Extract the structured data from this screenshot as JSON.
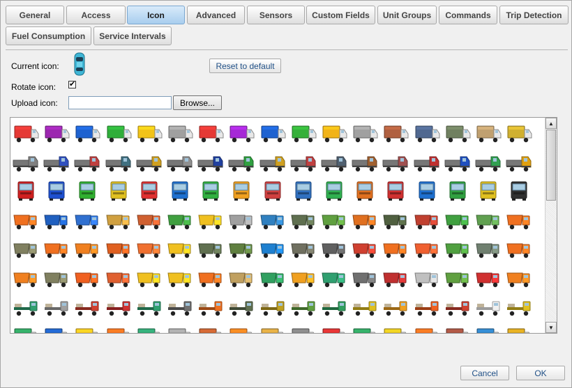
{
  "tabs": [
    {
      "label": "General",
      "active": false
    },
    {
      "label": "Access",
      "active": false
    },
    {
      "label": "Icon",
      "active": true
    },
    {
      "label": "Advanced",
      "active": false
    },
    {
      "label": "Sensors",
      "active": false
    },
    {
      "label": "Custom Fields",
      "active": false
    },
    {
      "label": "Unit Groups",
      "active": false
    },
    {
      "label": "Commands",
      "active": false
    },
    {
      "label": "Trip Detection",
      "active": false
    },
    {
      "label": "Fuel Consumption",
      "active": false
    },
    {
      "label": "Service Intervals",
      "active": false
    }
  ],
  "icon_form": {
    "current_icon_label": "Current icon:",
    "current_icon_name": "car-topview-icon",
    "current_icon_color": "#3fb6d6",
    "reset_label": "Reset to default",
    "rotate_label": "Rotate icon:",
    "rotate_checked": true,
    "rotate_mark": "✔",
    "upload_label": "Upload icon:",
    "upload_value": "",
    "browse_label": "Browse..."
  },
  "gallery": {
    "name": "vehicle-icon-gallery",
    "rows": [
      {
        "kind": "box-truck",
        "colors": [
          "#e53935",
          "#9c27b0",
          "#1e62d0",
          "#2fae3a",
          "#f2c318",
          "#a0a0a0",
          "#e53935",
          "#a629d6",
          "#1e62d0",
          "#35b03a",
          "#f2b318",
          "#a0a0a0",
          "#b06040",
          "#506890",
          "#708060",
          "#c0a070",
          "#d0b030"
        ]
      },
      {
        "kind": "semi-truck",
        "colors": [
          "#808080",
          "#3050c0",
          "#c04040",
          "#407080",
          "#d0a020",
          "#909090",
          "#2040a0",
          "#30a040",
          "#d0a020",
          "#c04040",
          "#506070",
          "#a06030",
          "#a05050",
          "#c03030",
          "#2050c0",
          "#30a050",
          "#e0a010"
        ]
      },
      {
        "kind": "cab-front",
        "colors": [
          "#d02020",
          "#1e50d0",
          "#30b030",
          "#e0c020",
          "#e03030",
          "#1e70d0",
          "#30b040",
          "#f0a020",
          "#d04040",
          "#3070c0",
          "#30b050",
          "#e07020",
          "#d03030",
          "#1e70d0",
          "#30a040",
          "#e0c020",
          "#303030"
        ]
      },
      {
        "kind": "dump-truck",
        "colors": [
          "#f07020",
          "#2060c0",
          "#3070d0",
          "#d0a040",
          "#d06030",
          "#40a040",
          "#f0c020",
          "#a0a0a0",
          "#3080c0",
          "#607050",
          "#60a040",
          "#e07020",
          "#506040",
          "#c04030",
          "#40a040",
          "#60a050",
          "#f07020"
        ]
      },
      {
        "kind": "dump-truck",
        "colors": [
          "#808060",
          "#f07020",
          "#f08020",
          "#e06020",
          "#f07030",
          "#f0c020",
          "#607050",
          "#608040",
          "#1e80d0",
          "#707060",
          "#606060",
          "#d04030",
          "#f07020",
          "#f06030",
          "#50a040",
          "#708070",
          "#f07020"
        ]
      },
      {
        "kind": "dump-truck",
        "colors": [
          "#f08020",
          "#808060",
          "#f06020",
          "#e06030",
          "#f0c020",
          "#f0c020",
          "#f07020",
          "#c0a060",
          "#30a060",
          "#f0a020",
          "#30a070",
          "#707070",
          "#c03030",
          "#c0c0c0",
          "#60a040",
          "#d03030",
          "#f08020"
        ]
      },
      {
        "kind": "flatbed-truck",
        "colors": [
          "#30a070",
          "#a0a0a0",
          "#d04030",
          "#d03030",
          "#30a070",
          "#707070",
          "#f07020",
          "#607050",
          "#c0a020",
          "#60a040",
          "#30a060",
          "#e0c020",
          "#f0a020",
          "#f06020",
          "#d04030",
          "#f0f0f0",
          "#e0c020"
        ]
      },
      {
        "kind": "box-truck",
        "colors": [
          "#30a060",
          "#2060c0",
          "#f0c020",
          "#f07020",
          "#30a070",
          "#a0a0a0",
          "#c06030",
          "#f08020",
          "#d0a040",
          "#808080",
          "#d03030",
          "#30a060",
          "#e0c020",
          "#f07020",
          "#a05040",
          "#3080c0",
          "#d0a020"
        ]
      }
    ]
  }
}
